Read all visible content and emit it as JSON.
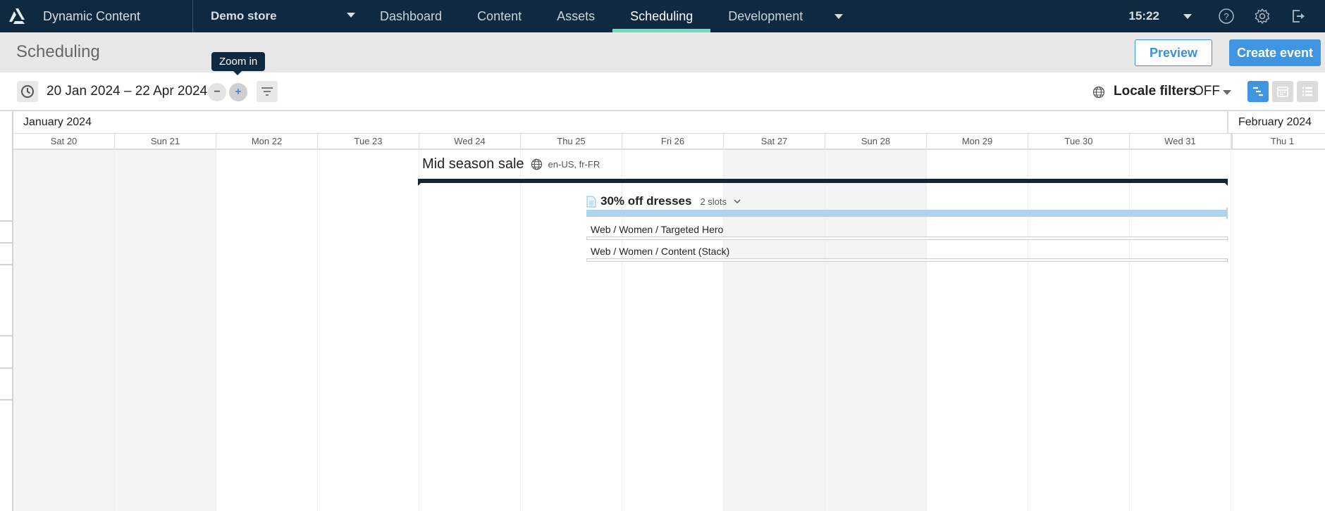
{
  "app": {
    "title": "Dynamic Content",
    "store": "Demo store",
    "nav": [
      {
        "label": "Dashboard",
        "active": false
      },
      {
        "label": "Content",
        "active": false
      },
      {
        "label": "Assets",
        "active": false
      },
      {
        "label": "Scheduling",
        "active": true
      },
      {
        "label": "Development",
        "active": false
      }
    ],
    "time": "15:22",
    "icons": [
      "help-icon",
      "settings-icon",
      "logout-icon"
    ]
  },
  "page": {
    "title": "Scheduling",
    "preview_label": "Preview",
    "create_label": "Create event"
  },
  "toolbar": {
    "date_range": "20 Jan 2024 – 22 Apr 2024",
    "zoom_out_symbol": "−",
    "zoom_in_symbol": "+",
    "tooltip": "Zoom in",
    "locale_label": "Locale filters",
    "locale_value": "OFF",
    "active_view": "timeline"
  },
  "timeline": {
    "months": [
      {
        "label": "January 2024"
      },
      {
        "label": "February 2024"
      }
    ],
    "days": [
      {
        "label": "Sat 20",
        "weekend": true
      },
      {
        "label": "Sun 21",
        "weekend": true
      },
      {
        "label": "Mon 22",
        "weekend": false
      },
      {
        "label": "Tue 23",
        "weekend": false
      },
      {
        "label": "Wed 24",
        "weekend": false
      },
      {
        "label": "Thu 25",
        "weekend": false
      },
      {
        "label": "Fri 26",
        "weekend": false
      },
      {
        "label": "Sat 27",
        "weekend": true
      },
      {
        "label": "Sun 28",
        "weekend": true
      },
      {
        "label": "Mon 29",
        "weekend": false
      },
      {
        "label": "Tue 30",
        "weekend": false
      },
      {
        "label": "Wed 31",
        "weekend": false
      },
      {
        "label": "Thu 1",
        "weekend": false
      }
    ],
    "event": {
      "name": "Mid season sale",
      "locales": "en-US, fr-FR",
      "edition": {
        "name": "30% off dresses",
        "slots_label": "2 slots",
        "slots": [
          {
            "label": "Web / Women / Targeted Hero"
          },
          {
            "label": "Web / Women / Content (Stack)"
          }
        ]
      }
    }
  },
  "colors": {
    "nav_bg": "#0f2a40",
    "nav_active_underline": "#6fdcc0",
    "primary": "#3f95e0",
    "event_bar": "#152536",
    "edition_bar": "#aed3ea"
  }
}
